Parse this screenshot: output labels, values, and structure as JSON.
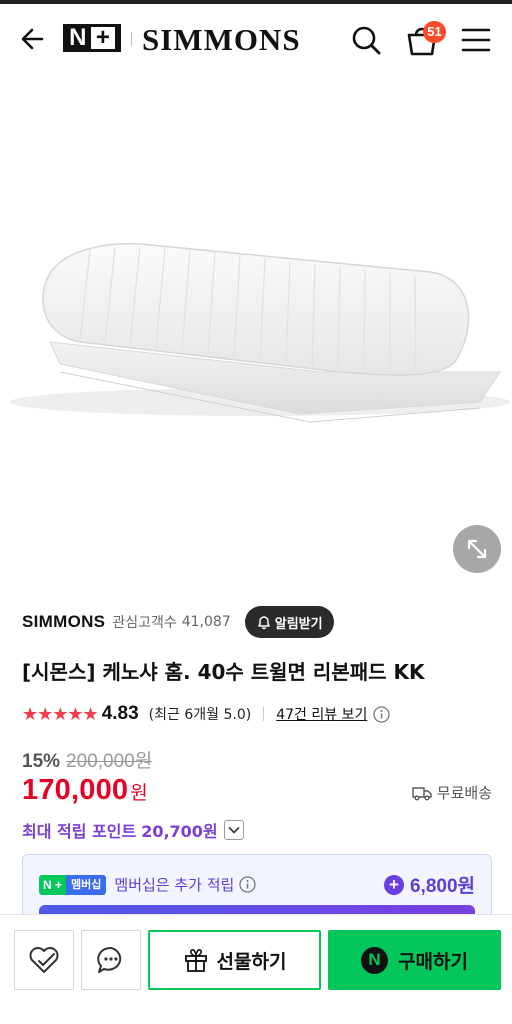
{
  "header": {
    "np_logo": {
      "n": "N",
      "plus": "+"
    },
    "brand_logo": "SIMMONS",
    "cart_count": "51"
  },
  "product": {
    "brand": "SIMMONS",
    "interest_label": "관심고객수",
    "interest_count": "41,087",
    "alarm_label": "알림받기",
    "title": "[시몬스] 케노샤 홈. 40수 트윌면 리본패드 KK",
    "stars": "★★★★★",
    "rating": "4.83",
    "rating_recent": "(최근 6개월 5.0)",
    "review_link": "47건 리뷰 보기",
    "discount_rate": "15%",
    "original_price": "200,000원",
    "sale_price": "170,000",
    "currency": "원",
    "shipping": "무료배송",
    "max_points_label": "최대 적립 포인트",
    "max_points_value": "20,700원"
  },
  "membership": {
    "badge_np": "N +",
    "badge_text": "멤버십",
    "text": "멤버십은 추가 적립",
    "points": "6,800원"
  },
  "bottom_bar": {
    "gift_label": "선물하기",
    "buy_label": "구매하기",
    "buy_icon_letter": "N"
  },
  "colors": {
    "accent_green": "#03c75a",
    "price_red": "#e60023",
    "points_purple": "#7b3fd6",
    "cart_badge": "#ff4a2b"
  },
  "icons": [
    "back-arrow-icon",
    "search-icon",
    "cart-icon",
    "menu-icon",
    "expand-icon",
    "bell-icon",
    "info-icon",
    "truck-icon",
    "chevron-down-icon",
    "heart-check-icon",
    "chat-icon",
    "gift-icon"
  ]
}
